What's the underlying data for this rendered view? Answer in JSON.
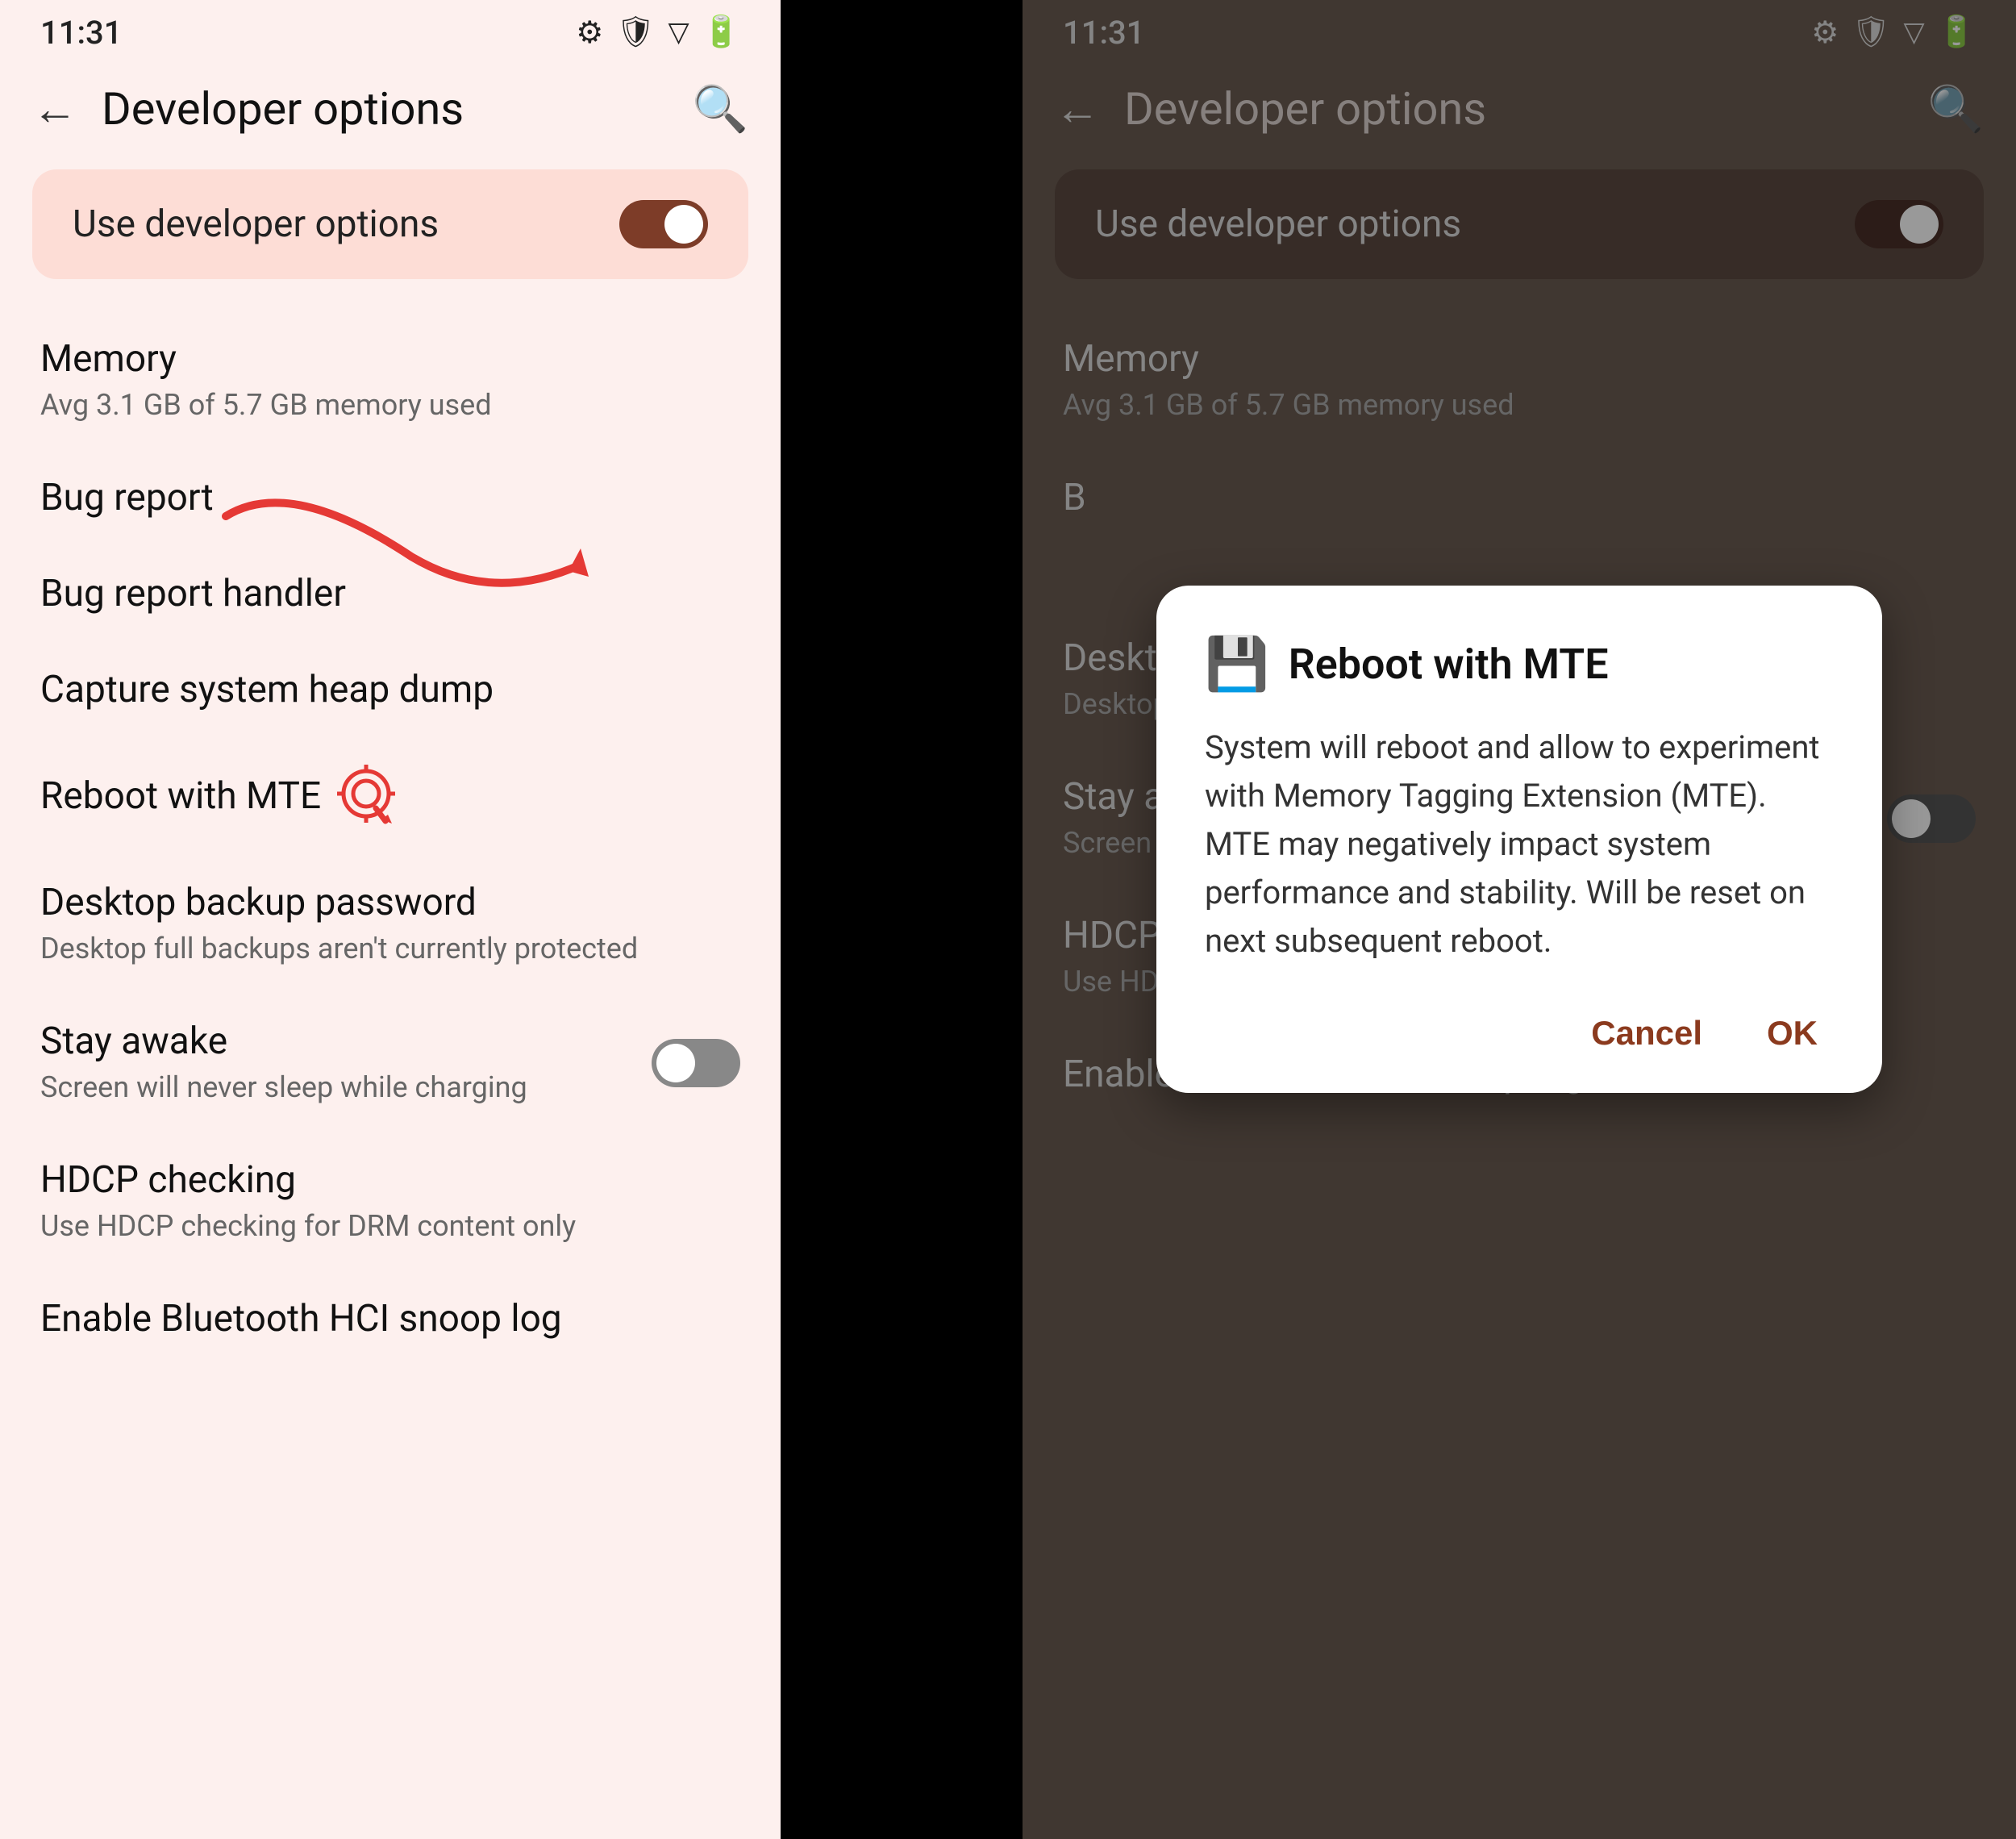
{
  "left": {
    "statusBar": {
      "time": "11:31",
      "icons": [
        "⚙",
        "🛡",
        "▽",
        "🔋"
      ]
    },
    "nav": {
      "back": "←",
      "title": "Developer options",
      "search": "🔍"
    },
    "devOptionsCard": {
      "label": "Use developer options",
      "toggleState": "on"
    },
    "items": [
      {
        "title": "Memory",
        "sub": "Avg 3.1 GB of 5.7 GB memory used",
        "hasToggle": false
      },
      {
        "title": "Bug report",
        "sub": "",
        "hasToggle": false
      },
      {
        "title": "Bug report handler",
        "sub": "",
        "hasToggle": false
      },
      {
        "title": "Capture system heap dump",
        "sub": "",
        "hasToggle": false
      },
      {
        "title": "Reboot with MTE",
        "sub": "",
        "hasToggle": false,
        "hasMteIcon": true
      },
      {
        "title": "Desktop backup password",
        "sub": "Desktop full backups aren't currently protected",
        "hasToggle": false
      },
      {
        "title": "Stay awake",
        "sub": "Screen will never sleep while charging",
        "hasToggle": true,
        "toggleState": "off"
      },
      {
        "title": "HDCP checking",
        "sub": "Use HDCP checking for DRM content only",
        "hasToggle": false
      },
      {
        "title": "Enable Bluetooth HCI snoop log",
        "sub": "",
        "hasToggle": false
      }
    ]
  },
  "right": {
    "statusBar": {
      "time": "11:31"
    },
    "nav": {
      "back": "←",
      "title": "Developer options",
      "search": "🔍"
    },
    "devOptionsCard": {
      "label": "Use developer options",
      "toggleState": "on"
    },
    "items": [
      {
        "title": "Memory",
        "sub": "Avg 3.1 GB of 5.7 GB memory used"
      },
      {
        "title": "B",
        "sub": ""
      },
      {
        "title": "Desktop backup password",
        "sub": "Desktop full backups aren't currently protected"
      },
      {
        "title": "Stay awake",
        "sub": "Screen will never sleep while charging",
        "hasToggle": true,
        "toggleState": "off"
      },
      {
        "title": "HDCP checking",
        "sub": "Use HDCP checking for DRM content only"
      },
      {
        "title": "Enable Bluetooth HCI snoop log",
        "sub": ""
      }
    ],
    "dialog": {
      "title": "Reboot with MTE",
      "body": "System will reboot and allow to experiment with Memory Tagging Extension (MTE). MTE may negatively impact system performance and stability. Will be reset on next subsequent reboot.",
      "cancelLabel": "Cancel",
      "okLabel": "OK"
    }
  }
}
